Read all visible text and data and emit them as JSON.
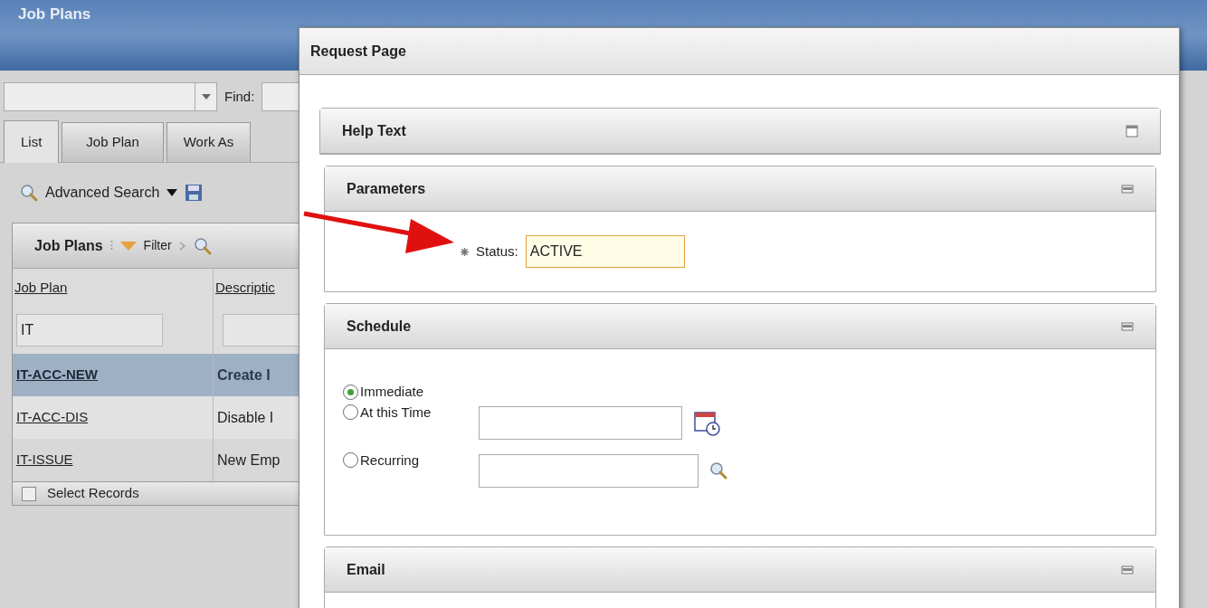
{
  "app": {
    "title": "Job Plans",
    "find_label": "Find:",
    "tabs": [
      {
        "label": "List",
        "selected": true
      },
      {
        "label": "Job Plan",
        "selected": false
      },
      {
        "label": "Work As",
        "selected": false
      }
    ],
    "advanced_search": "Advanced Search",
    "table": {
      "title": "Job Plans",
      "filter": "Filter",
      "columns": [
        "Job Plan",
        "Descriptic"
      ],
      "filter_values": [
        "IT"
      ],
      "rows": [
        {
          "job_plan": "IT-ACC-NEW",
          "description": "Create I",
          "selected": true
        },
        {
          "job_plan": "IT-ACC-DIS",
          "description": "Disable I",
          "selected": false
        },
        {
          "job_plan": "IT-ISSUE",
          "description": "New Emp",
          "selected": false
        }
      ],
      "select_records": {
        "label": "Select Records",
        "checked": false
      }
    }
  },
  "dialog": {
    "title": "Request Page",
    "sections": [
      {
        "kind": "help",
        "title": "Help Text",
        "expanded": false
      },
      {
        "kind": "parameters",
        "title": "Parameters",
        "expanded": true,
        "field": {
          "label": "Status:",
          "value": "ACTIVE",
          "required": true
        }
      },
      {
        "kind": "schedule",
        "title": "Schedule",
        "expanded": true,
        "options": [
          {
            "label": "Immediate",
            "selected": true,
            "kind": "plain"
          },
          {
            "label": "At this Time",
            "selected": false,
            "kind": "datetime"
          },
          {
            "label": "Recurring",
            "selected": false,
            "kind": "lookup"
          }
        ]
      },
      {
        "kind": "email",
        "title": "Email",
        "expanded": true
      }
    ]
  }
}
